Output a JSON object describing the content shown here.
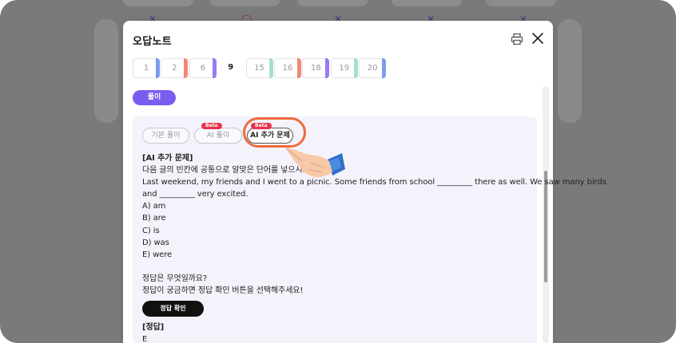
{
  "modal": {
    "title": "오답노트",
    "print_icon": "printer-icon",
    "close_icon": "close-icon"
  },
  "question_numbers": [
    "1",
    "2",
    "6",
    "9",
    "15",
    "16",
    "18",
    "19",
    "20"
  ],
  "active_question": "9",
  "solution_button": "풀이",
  "tabs": {
    "basic": "기본 풀이",
    "ai_solution": "AI 풀이",
    "ai_extra": "AI 추가 문제",
    "beta_label": "Beta"
  },
  "content": {
    "heading": "[AI 추가 문제]",
    "instruction": "다음 글의 빈칸에 공통으로 알맞은 단어를 넣으시오.",
    "passage_line1": "Last weekend, my friends and I went to a picnic. Some friends from school _________ there as well. We saw many birds",
    "passage_line2": "and _________ very excited.",
    "options": [
      "A) am",
      "B) are",
      "C) is",
      "D) was",
      "E) were"
    ],
    "prompt1": "정답은 무엇일까요?",
    "prompt2": "정답이 궁금하면 정답 확인 버튼을 선택해주세요!",
    "check_button": "정답 확인",
    "answer_heading": "[정답]",
    "answer": "E"
  },
  "colors": {
    "accent_purple": "#7a5cf0",
    "highlight_ring": "#f06a3c",
    "beta_badge": "#e7334a",
    "panel_bg": "#f4f3fb"
  }
}
